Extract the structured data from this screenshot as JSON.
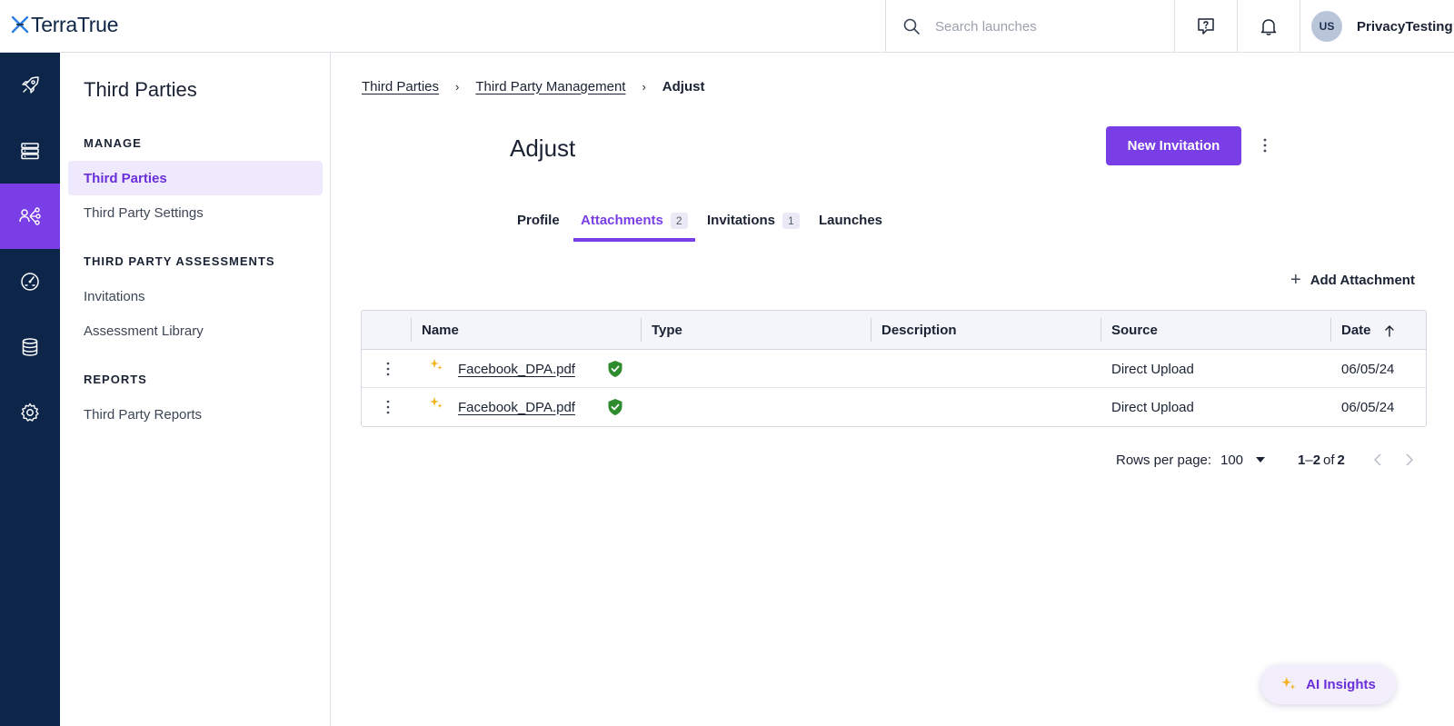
{
  "brand": {
    "name": "TerraTrue"
  },
  "topbar": {
    "search_placeholder": "Search launches",
    "user_initials": "US",
    "user_name": "PrivacyTesting"
  },
  "rail": {
    "items": [
      {
        "icon": "rocket-icon"
      },
      {
        "icon": "server-icon"
      },
      {
        "icon": "third-parties-icon",
        "active": true
      },
      {
        "icon": "gauge-icon"
      },
      {
        "icon": "database-icon"
      },
      {
        "icon": "gear-icon"
      }
    ]
  },
  "sidebar": {
    "title": "Third Parties",
    "sections": [
      {
        "heading": "MANAGE",
        "items": [
          "Third Parties",
          "Third Party Settings"
        ]
      },
      {
        "heading": "THIRD PARTY ASSESSMENTS",
        "items": [
          "Invitations",
          "Assessment Library"
        ]
      },
      {
        "heading": "REPORTS",
        "items": [
          "Third Party Reports"
        ]
      }
    ],
    "active_item": "Third Parties"
  },
  "breadcrumb": {
    "items": [
      "Third Parties",
      "Third Party Management"
    ],
    "current": "Adjust",
    "separator": "›"
  },
  "page": {
    "title": "Adjust",
    "new_invitation_label": "New Invitation"
  },
  "tabs": [
    {
      "label": "Profile",
      "count": null
    },
    {
      "label": "Attachments",
      "count": "2",
      "active": true
    },
    {
      "label": "Invitations",
      "count": "1"
    },
    {
      "label": "Launches",
      "count": null
    }
  ],
  "attachments": {
    "add_label": "Add Attachment",
    "columns": [
      "Name",
      "Type",
      "Description",
      "Source",
      "Date"
    ],
    "sort_column": "Date",
    "rows": [
      {
        "name": "Facebook_DPA.pdf",
        "type": "",
        "description": "",
        "source": "Direct Upload",
        "date": "06/05/24",
        "verified": true
      },
      {
        "name": "Facebook_DPA.pdf",
        "type": "",
        "description": "",
        "source": "Direct Upload",
        "date": "06/05/24",
        "verified": true
      }
    ]
  },
  "pagination": {
    "rows_per_page_label": "Rows per page:",
    "rows_per_page": "100",
    "range_start": "1",
    "range_dash": "–",
    "range_end": "2",
    "of_label": "of",
    "total": "2"
  },
  "ai_insights": {
    "label": "AI Insights"
  },
  "colors": {
    "accent": "#7a3ee6",
    "rail": "#0c2548",
    "spark": "#f3b21b",
    "verified": "#2e8b2e"
  }
}
